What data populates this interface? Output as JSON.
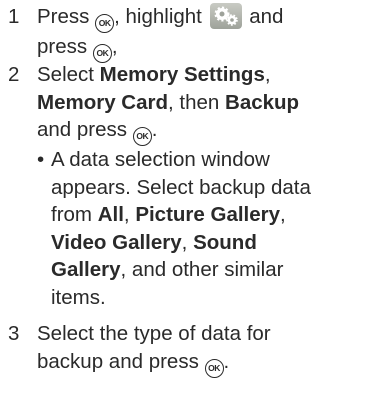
{
  "steps": [
    {
      "number": "1",
      "parts": {
        "a": "Press ",
        "b": ", highlight ",
        "c": " and",
        "d": "press ",
        "e": ","
      }
    },
    {
      "number": "2",
      "parts": {
        "a": "Select ",
        "b_bold": "Memory Settings",
        "c": ",",
        "d_bold": "Memory Card",
        "e": ", then ",
        "f_bold": "Backup",
        "g": "and press ",
        "h": "."
      },
      "bullet": {
        "marker": "•",
        "line1": "A data selection window",
        "line2": "appears. Select backup data",
        "line3_pre": "from ",
        "all_bold": "All",
        "line3_mid": ", ",
        "picture_bold": "Picture Gallery",
        "line3_post": ",",
        "video_bold": "Video Gallery",
        "line4_mid": ", ",
        "sound_bold": "Sound",
        "gallery_bold": "Gallery",
        "line5_post": ", and other similar",
        "line6": "items."
      }
    },
    {
      "number": "3",
      "parts": {
        "a": "Select the type of data for",
        "b": "backup and press ",
        "c": "."
      }
    }
  ],
  "icons": {
    "ok_label": "OK",
    "settings_icon": "settings-gears-icon"
  }
}
